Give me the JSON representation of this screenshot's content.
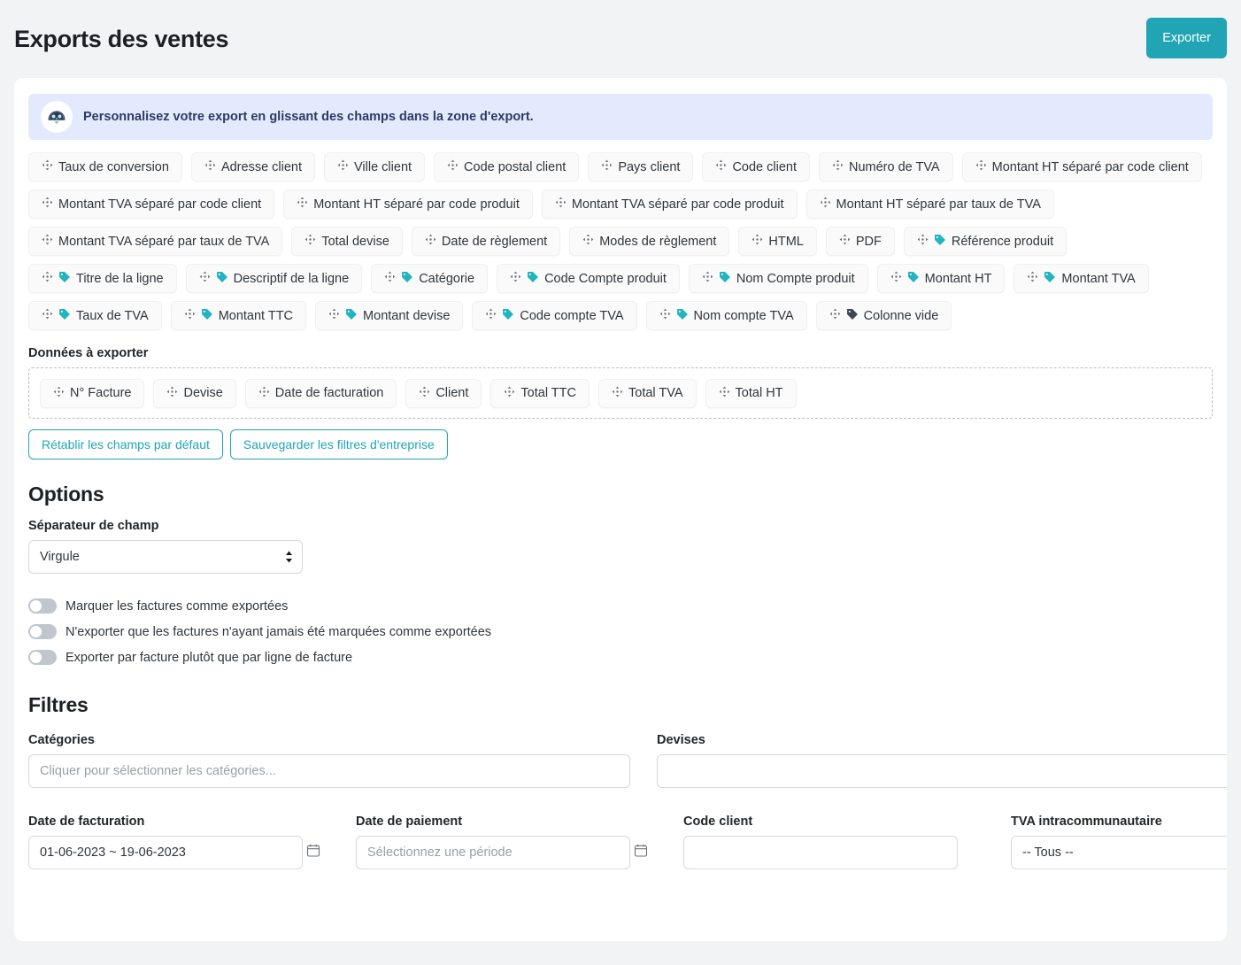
{
  "header": {
    "title": "Exports des ventes",
    "export_button": "Exporter"
  },
  "banner": {
    "icon": "robot-mascot-icon",
    "text": "Personnalisez votre export en glissant des champs dans la zone d'export."
  },
  "available_fields": [
    {
      "label": "Taux de conversion",
      "tag": "none"
    },
    {
      "label": "Adresse client",
      "tag": "none"
    },
    {
      "label": "Ville client",
      "tag": "none"
    },
    {
      "label": "Code postal client",
      "tag": "none"
    },
    {
      "label": "Pays client",
      "tag": "none"
    },
    {
      "label": "Code client",
      "tag": "none"
    },
    {
      "label": "Numéro de TVA",
      "tag": "none"
    },
    {
      "label": "Montant HT séparé par code client",
      "tag": "none"
    },
    {
      "label": "Montant TVA séparé par code client",
      "tag": "none"
    },
    {
      "label": "Montant HT séparé par code produit",
      "tag": "none"
    },
    {
      "label": "Montant TVA séparé par code produit",
      "tag": "none"
    },
    {
      "label": "Montant HT séparé par taux de TVA",
      "tag": "none"
    },
    {
      "label": "Montant TVA séparé par taux de TVA",
      "tag": "none"
    },
    {
      "label": "Total devise",
      "tag": "none"
    },
    {
      "label": "Date de règlement",
      "tag": "none"
    },
    {
      "label": "Modes de règlement",
      "tag": "none"
    },
    {
      "label": "HTML",
      "tag": "none"
    },
    {
      "label": "PDF",
      "tag": "none"
    },
    {
      "label": "Référence produit",
      "tag": "teal"
    },
    {
      "label": "Titre de la ligne",
      "tag": "teal"
    },
    {
      "label": "Descriptif de la ligne",
      "tag": "teal"
    },
    {
      "label": "Catégorie",
      "tag": "teal"
    },
    {
      "label": "Code Compte produit",
      "tag": "teal"
    },
    {
      "label": "Nom Compte produit",
      "tag": "teal"
    },
    {
      "label": "Montant HT",
      "tag": "teal"
    },
    {
      "label": "Montant TVA",
      "tag": "teal"
    },
    {
      "label": "Taux de TVA",
      "tag": "teal"
    },
    {
      "label": "Montant TTC",
      "tag": "teal"
    },
    {
      "label": "Montant devise",
      "tag": "teal"
    },
    {
      "label": "Code compte TVA",
      "tag": "teal"
    },
    {
      "label": "Nom compte TVA",
      "tag": "teal"
    },
    {
      "label": "Colonne vide",
      "tag": "dark"
    }
  ],
  "dropzone": {
    "label": "Données à exporter",
    "fields": [
      {
        "label": "N° Facture",
        "tag": "none"
      },
      {
        "label": "Devise",
        "tag": "none"
      },
      {
        "label": "Date de facturation",
        "tag": "none"
      },
      {
        "label": "Client",
        "tag": "none"
      },
      {
        "label": "Total TTC",
        "tag": "none"
      },
      {
        "label": "Total TVA",
        "tag": "none"
      },
      {
        "label": "Total HT",
        "tag": "none"
      }
    ]
  },
  "field_actions": {
    "reset": "Rétablir les champs par défaut",
    "save": "Sauvegarder les filtres d'entreprise"
  },
  "options": {
    "title": "Options",
    "separator_label": "Séparateur de champ",
    "separator_value": "Virgule",
    "toggles": [
      {
        "label": "Marquer les factures comme exportées",
        "on": false
      },
      {
        "label": "N'exporter que les factures n'ayant jamais été marquées comme exportées",
        "on": false
      },
      {
        "label": "Exporter par facture plutôt que par ligne de facture",
        "on": false
      }
    ]
  },
  "filters": {
    "title": "Filtres",
    "categories": {
      "label": "Catégories",
      "value": "",
      "placeholder": "Cliquer pour sélectionner les catégories..."
    },
    "devises": {
      "label": "Devises",
      "value": "",
      "placeholder": ""
    },
    "date_facturation": {
      "label": "Date de facturation",
      "value": "01-06-2023 ~ 19-06-2023",
      "placeholder": "Sélectionnez une période",
      "icon": "calendar-icon"
    },
    "date_paiement": {
      "label": "Date de paiement",
      "value": "",
      "placeholder": "Sélectionnez une période",
      "icon": "calendar-icon"
    },
    "code_client": {
      "label": "Code client",
      "value": "",
      "placeholder": ""
    },
    "tva_intra": {
      "label": "TVA intracommunautaire",
      "value": "-- Tous --"
    }
  },
  "colors": {
    "accent": "#21a5b4",
    "banner_bg": "#e3eafd",
    "banner_text": "#2d3a63",
    "page_bg": "#f2f3f5",
    "tag_teal": "#21b5bf",
    "tag_dark": "#3f4750"
  }
}
